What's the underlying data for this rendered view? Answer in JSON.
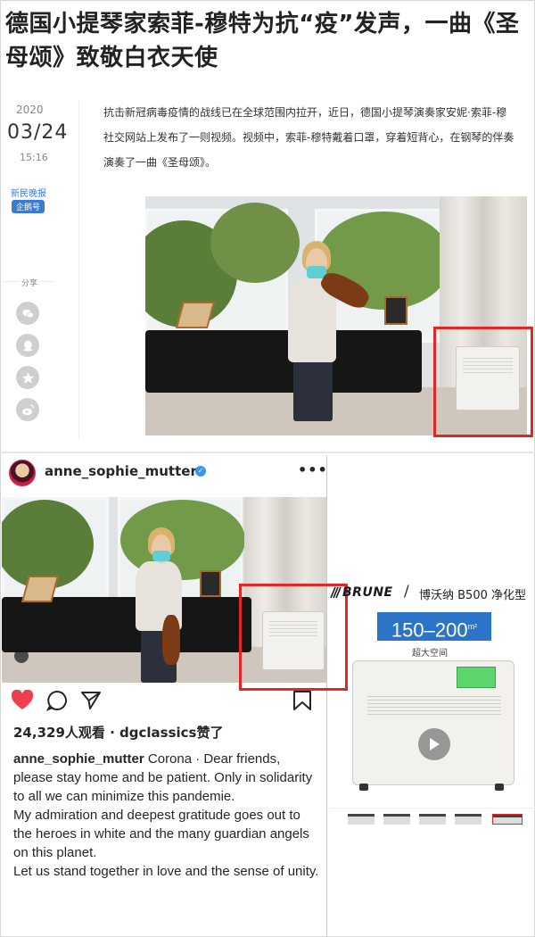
{
  "article": {
    "headline": "德国小提琴家索菲-穆特为抗“疫”发声，一曲《圣母颂》致敬白衣天使",
    "meta": {
      "year": "2020",
      "date": "03/24",
      "time": "15:16",
      "source": "新民晚报",
      "badge": "企鹅号",
      "share_label": "分享"
    },
    "share_icons": [
      "wechat-icon",
      "qq-icon",
      "favorite-icon",
      "weibo-icon"
    ],
    "body_lines": [
      "抗击新冠病毒疫情的战线已在全球范围内拉开，近日，德国小提琴演奏家安妮·索菲-穆",
      "社交网站上发布了一则视频。视频中，索菲-穆特戴着口罩，穿着短背心，在钢琴的伴奏",
      "演奏了一曲《圣母颂》。"
    ]
  },
  "instagram": {
    "username": "anne_sophie_mutter",
    "views_line": "24,329人观看 · dgclassics赞了",
    "caption_user": "anne_sophie_mutter",
    "caption_lines": [
      "Corona · Dear friends,",
      "please stay home and be patient. Only in solidarity to all we can minimize this pandemie.",
      "My admiration and deepest gratitude goes out to the heroes in white and the many guardian angels on this planet.",
      "Let us stand together in love and the sense of unity."
    ],
    "icons": [
      "heart-icon",
      "comment-icon",
      "share-icon",
      "bookmark-icon"
    ],
    "liked": true
  },
  "product": {
    "brand": "BRUNE",
    "name": "博沃纳 B500 净化型",
    "area": "150–200",
    "area_unit": "m²",
    "area_sub": "超大空间",
    "colors": {
      "banner": "#2b74c8",
      "highlight": "#e32626"
    }
  }
}
